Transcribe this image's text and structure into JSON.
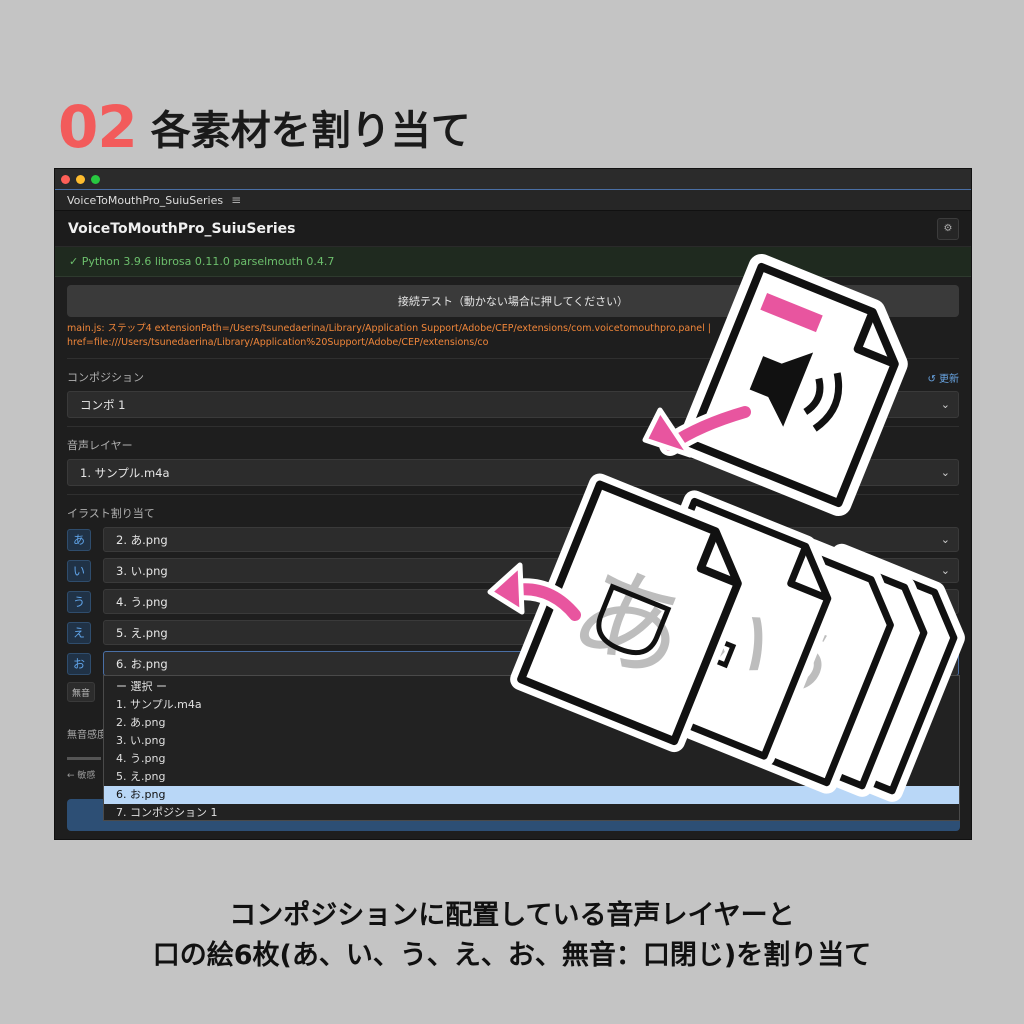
{
  "heading": {
    "number": "02",
    "title": "各素材を割り当て"
  },
  "window": {
    "tab_label": "VoiceToMouthPro_SuiuSeries",
    "menu_glyph": "≡",
    "app_title": "VoiceToMouthPro_SuiuSeries",
    "status": "✓ Python 3.9.6 librosa 0.11.0 parselmouth 0.4.7",
    "test_button": "接続テスト（動かない場合に押してください）",
    "log_line1": "main.js: ステップ4 extensionPath=/Users/tsunedaerina/Library/Application Support/Adobe/CEP/extensions/com.voicetomouthpro.panel |",
    "log_line2": "href=file:///Users/tsunedaerina/Library/Application%20Support/Adobe/CEP/extensions/co",
    "composition": {
      "label": "コンポジション",
      "refresh": "↺ 更新",
      "value": "コンポ 1"
    },
    "audio_layer": {
      "label": "音声レイヤー",
      "value": "1. サンプル.m4a"
    },
    "illust": {
      "label": "イラスト割り当て",
      "rows": [
        {
          "badge": "あ",
          "value": "2. あ.png"
        },
        {
          "badge": "い",
          "value": "3. い.png"
        },
        {
          "badge": "う",
          "value": "4. う.png"
        },
        {
          "badge": "え",
          "value": "5. え.png"
        },
        {
          "badge": "お",
          "value": "6. お.png"
        }
      ],
      "mute_badge": "無音"
    },
    "dropdown_options": [
      "ー 選択 ー",
      "1. サンプル.m4a",
      "2. あ.png",
      "3. い.png",
      "4. う.png",
      "5. え.png",
      "6. お.png",
      "7. コンポジション 1"
    ],
    "dropdown_selected": "6. お.png",
    "sensitivity_label": "無音感度",
    "sensitivity_left": "← 敏感"
  },
  "caption": {
    "line1": "コンポジションに配置している音声レイヤーと",
    "line2": "口の絵6枚(あ、い、う、え、お、無音：口閉じ)を割り当て"
  },
  "colors": {
    "accent_red": "#f25b5b",
    "arrow_pink": "#e8559f",
    "selected_option": "#b9d7f7",
    "badge_blue": "#5fa2e6",
    "status_green": "#6cbf6c",
    "log_orange": "#f0863a"
  },
  "icons": [
    "sound-file-icon",
    "mouth-file-icon",
    "arrow-left-icon",
    "gear-icon",
    "chevron-down-icon"
  ]
}
